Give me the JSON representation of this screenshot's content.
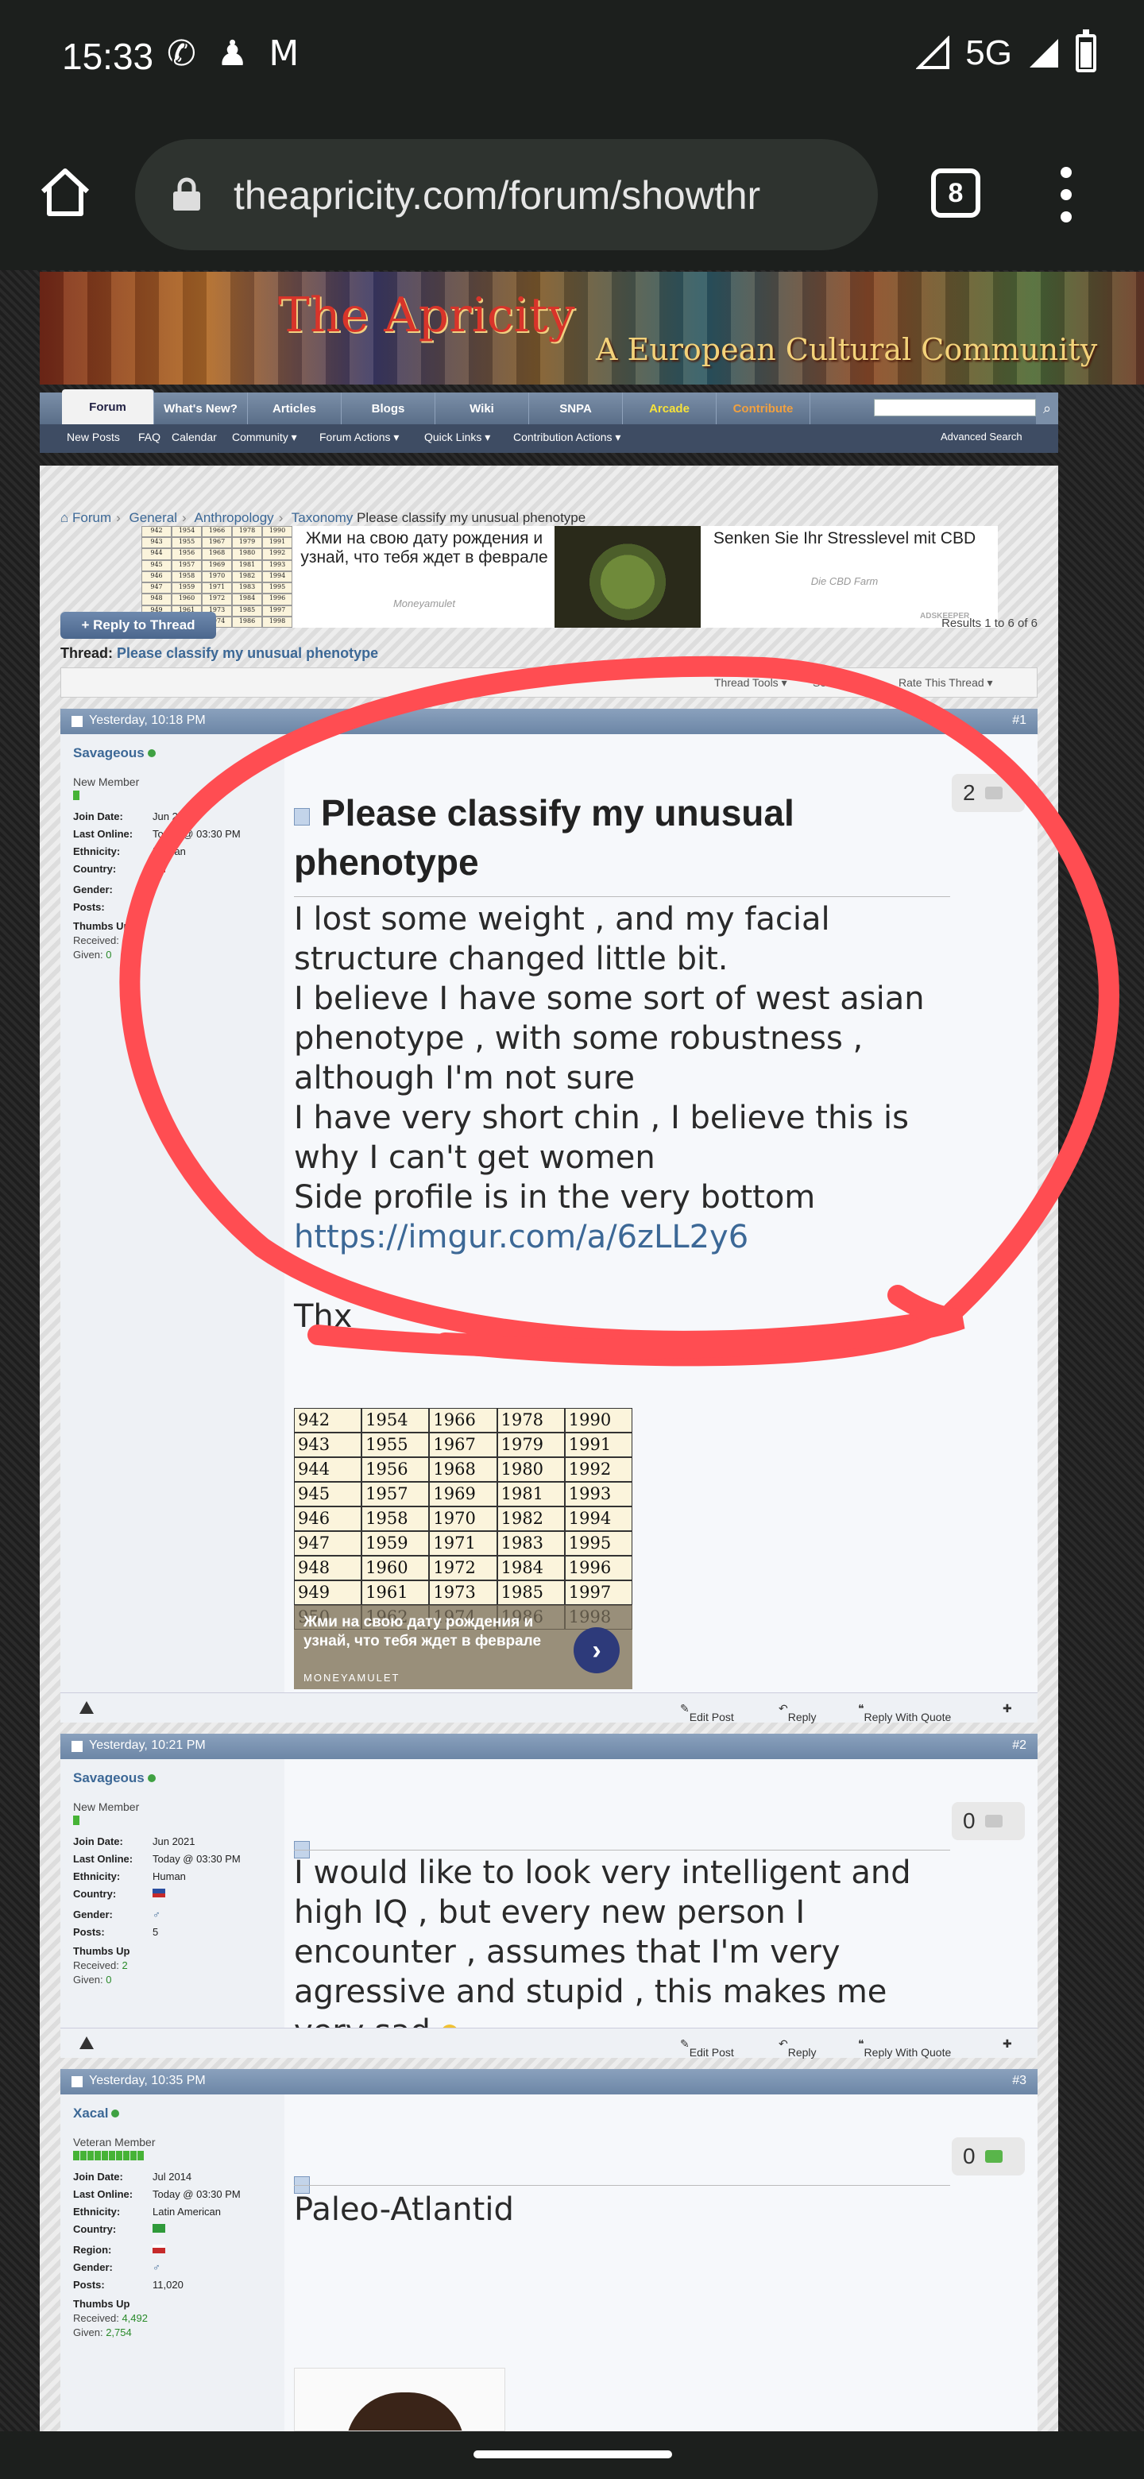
{
  "status": {
    "time": "15:33",
    "network": "5G"
  },
  "browser": {
    "url": "theapricity.com/forum/showthr",
    "tab_count": "8"
  },
  "banner": {
    "title": "The Apricity",
    "subtitle": "A European Cultural Community"
  },
  "nav": {
    "tabs": [
      "Forum",
      "What's New?",
      "Articles",
      "Blogs",
      "Wiki",
      "SNPA",
      "Arcade",
      "Contribute"
    ],
    "sub": [
      "New Posts",
      "FAQ",
      "Calendar",
      "Community ▾",
      "Forum Actions ▾",
      "Quick Links ▾",
      "Contribution Actions ▾"
    ],
    "advanced_search": "Advanced Search"
  },
  "breadcrumb": {
    "items": [
      "Forum",
      "General",
      "Anthropology",
      "Taxonomy"
    ],
    "current": "Please classify my unusual phenotype"
  },
  "ads": {
    "a1_text": "Жми на свою дату рождения и узнай, что тебя ждет в феврале",
    "a1_sponsor": "Moneyamulet",
    "a2_text": "Senken Sie Ihr Stresslevel mit CBD",
    "a2_sponsor": "Die CBD Farm",
    "keeper": "ADSKEEPER",
    "grid_numbers": [
      "942",
      "1954",
      "1966",
      "1978",
      "1990",
      "943",
      "1955",
      "1967",
      "1979",
      "1991",
      "944",
      "1956",
      "1968",
      "1980",
      "1992",
      "945",
      "1957",
      "1969",
      "1981",
      "1993",
      "946",
      "1958",
      "1970",
      "1982",
      "1994",
      "947",
      "1959",
      "1971",
      "1983",
      "1995",
      "948",
      "1960",
      "1972",
      "1984",
      "1996",
      "949",
      "1961",
      "1973",
      "1985",
      "1997",
      "950",
      "1962",
      "1974",
      "1986",
      "1998"
    ],
    "inpost_text": "Жми на свою дату рождения и узнай, что тебя ждет в феврале",
    "inpost_sponsor": "MONEYAMULET"
  },
  "thread": {
    "reply_label": "+ Reply to Thread",
    "results": "Results 1 to 6 of 6",
    "label": "Thread:",
    "title": "Please classify my unusual phenotype",
    "tools": [
      "Thread Tools ▾",
      "Search T",
      "Rate This Thread ▾"
    ]
  },
  "posts": [
    {
      "date": "Yesterday, 10:18 PM",
      "num": "#1",
      "user": "Savageous",
      "user_title": "New Member",
      "info": [
        [
          "Join Date:",
          "Jun 2021"
        ],
        [
          "Last Online:",
          "Today @ 03:30 PM"
        ],
        [
          "Ethnicity:",
          "Human"
        ],
        [
          "Country:",
          ""
        ],
        [
          "Gender:",
          ""
        ],
        [
          "Posts:",
          ""
        ],
        [
          "Thumbs Up",
          ""
        ],
        [
          "Received:",
          ""
        ],
        [
          "Given:",
          "0"
        ]
      ],
      "likes": "2",
      "title": "Please classify my unusual phenotype",
      "lines": [
        "I lost some weight , and my facial structure changed little bit.",
        "I believe I have some sort of west asian phenotype , with some robustness , although I'm not sure",
        "I have very short chin , I believe this is why I can't get women",
        "Side profile is in the very bottom"
      ],
      "link": "https://imgur.com/a/6zLL2y6",
      "sign": "Thx"
    },
    {
      "date": "Yesterday, 10:21 PM",
      "num": "#2",
      "user": "Savageous",
      "user_title": "New Member",
      "info": [
        [
          "Join Date:",
          "Jun 2021"
        ],
        [
          "Last Online:",
          "Today @ 03:30 PM"
        ],
        [
          "Ethnicity:",
          "Human"
        ],
        [
          "Country:",
          ""
        ],
        [
          "Gender:",
          ""
        ],
        [
          "Posts:",
          "5"
        ],
        [
          "Thumbs Up",
          ""
        ],
        [
          "Received:",
          "2"
        ],
        [
          "Given:",
          "0"
        ]
      ],
      "likes": "0",
      "text": "I would like to look very intelligent and high IQ , but every new person I encounter , assumes that I'm very agressive and stupid , this makes me very sad"
    },
    {
      "date": "Yesterday, 10:35 PM",
      "num": "#3",
      "user": "Xacal",
      "user_title": "Veteran Member",
      "info": [
        [
          "Join Date:",
          "Jul 2014"
        ],
        [
          "Last Online:",
          "Today @ 03:30 PM"
        ],
        [
          "Ethnicity:",
          "Latin American"
        ],
        [
          "Country:",
          ""
        ],
        [
          "Region:",
          ""
        ],
        [
          "Gender:",
          ""
        ],
        [
          "Posts:",
          "11,020"
        ],
        [
          "Thumbs Up",
          ""
        ],
        [
          "Received:",
          "4,492"
        ],
        [
          "Given:",
          "2,754"
        ]
      ],
      "likes": "0",
      "text": "Paleo-Atlantid"
    }
  ],
  "post_actions": [
    "Edit Post",
    "Reply",
    "Reply With Quote"
  ],
  "colors": {
    "annotation": "#ff4d52",
    "link": "#3c6896",
    "post_header": "#7b93b1"
  }
}
